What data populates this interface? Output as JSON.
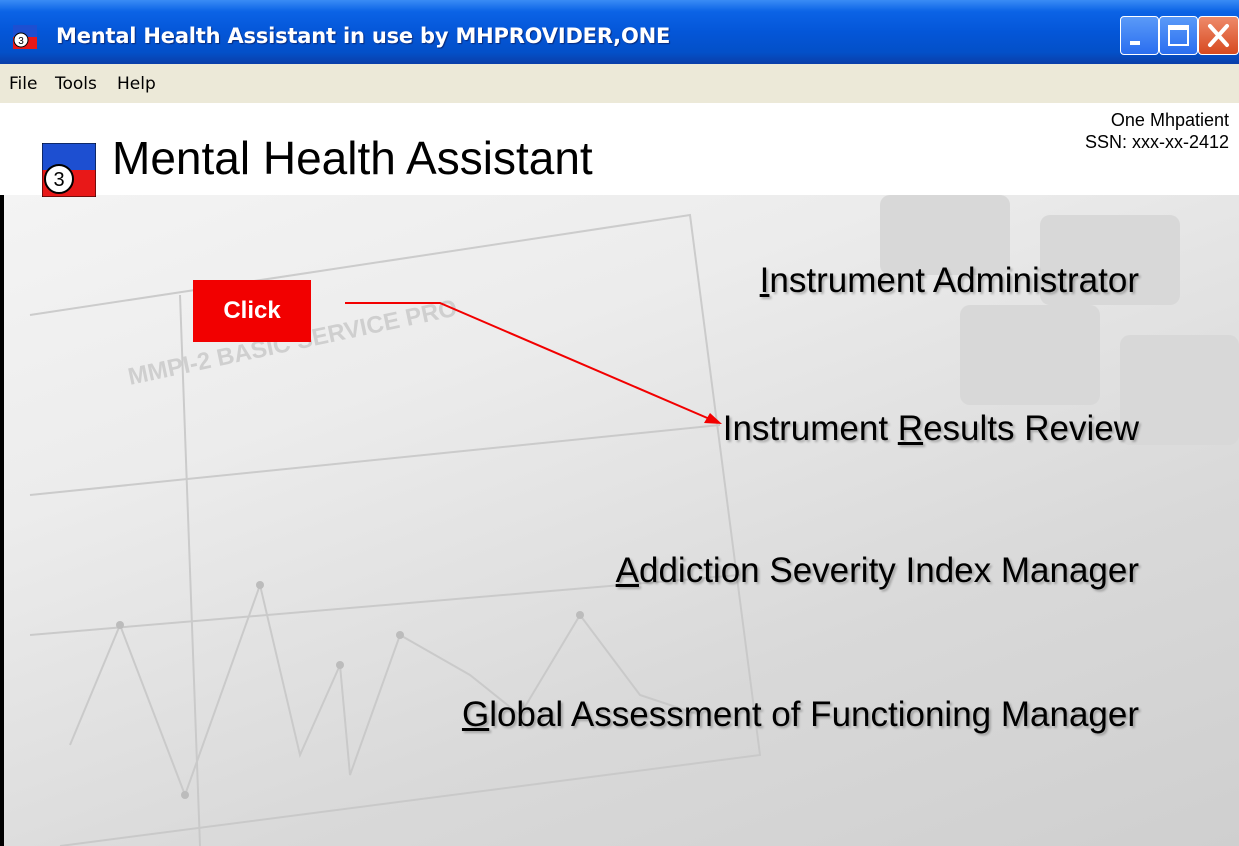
{
  "window": {
    "title": "Mental Health Assistant in use by MHPROVIDER,ONE"
  },
  "menu": {
    "items": [
      "File",
      "Tools",
      "Help"
    ]
  },
  "header": {
    "app_title": "Mental Health Assistant",
    "patient_name": "One Mhpatient",
    "patient_ssn": "SSN: xxx-xx-2412"
  },
  "nav": {
    "instrument_administrator": {
      "first": "I",
      "rest": "nstrument Administrator"
    },
    "instrument_results_review": {
      "pre": "Instrument ",
      "u": "R",
      "post": "esults Review"
    },
    "addiction_severity_index": {
      "first": "A",
      "rest": "ddiction Severity Index Manager"
    },
    "global_assessment": {
      "first": "G",
      "rest": "lobal Assessment of Functioning Manager"
    }
  },
  "annotation": {
    "label": "Click"
  },
  "background": {
    "watermark_text": "MMPI-2 BASIC SERVICE PRO"
  },
  "icons": {
    "app_logo": "mental-health-logo-icon",
    "minimize": "minimize-icon",
    "maximize": "maximize-icon",
    "close": "close-icon"
  },
  "colors": {
    "titlebar": "#0456d8",
    "close_button": "#d74a20",
    "annotation": "#f20000"
  }
}
